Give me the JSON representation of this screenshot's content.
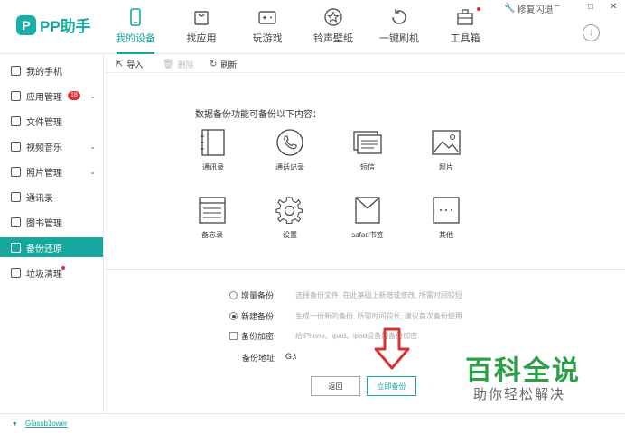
{
  "app": {
    "logo_mark": "P",
    "name": "PP助手"
  },
  "nav": [
    {
      "label": "我的设备",
      "icon": "phone-icon",
      "active": true
    },
    {
      "label": "找应用",
      "icon": "shopping-bag-icon"
    },
    {
      "label": "玩游戏",
      "icon": "gamepad-icon"
    },
    {
      "label": "铃声壁纸",
      "icon": "star-icon"
    },
    {
      "label": "一键刷机",
      "icon": "refresh-icon"
    },
    {
      "label": "工具箱",
      "icon": "toolbox-icon"
    }
  ],
  "window": {
    "repair_flash": "修复闪退",
    "minimize": "−",
    "maximize": "□",
    "close": "✕",
    "download": "↓"
  },
  "sidebar": [
    {
      "label": "我的手机"
    },
    {
      "label": "应用管理",
      "badge": "18",
      "chevron": "⌄"
    },
    {
      "label": "文件管理"
    },
    {
      "label": "视频音乐",
      "chevron": "⌄"
    },
    {
      "label": "照片管理",
      "chevron": "⌄"
    },
    {
      "label": "通讯录"
    },
    {
      "label": "图书管理"
    },
    {
      "label": "备份还原",
      "active": true
    },
    {
      "label": "垃圾清理"
    }
  ],
  "toolbar": {
    "import": "导入",
    "delete": "删除",
    "refresh": "刷新"
  },
  "backup": {
    "intro": "数据备份功能可备份以下内容：",
    "items": [
      "通讯录",
      "通话记录",
      "短信",
      "照片",
      "备忘录",
      "设置",
      "safari书签",
      "其他"
    ]
  },
  "options": {
    "incremental": {
      "label": "增量备份",
      "desc": "选择备份文件, 在此基础上新增或修改, 所需时间较短"
    },
    "new": {
      "label": "新建备份",
      "desc": "生成一份新的备份, 所需时间较长, 建议首次备份使用"
    },
    "encrypt": {
      "label": "备份加密",
      "desc": "给iPhone、ipad、ipod设备的备份加密"
    },
    "address_label": "备份地址",
    "address_value": "G:\\"
  },
  "buttons": {
    "back": "返回",
    "start": "立即备份"
  },
  "watermark": {
    "title": "百科全说",
    "subtitle": "助你轻松解决"
  },
  "status": {
    "user": "Glassb1ower"
  },
  "colors": {
    "accent": "#16a89f",
    "badge": "#e0323c",
    "arrow": "#d93030",
    "watermark": "#2aa147"
  }
}
